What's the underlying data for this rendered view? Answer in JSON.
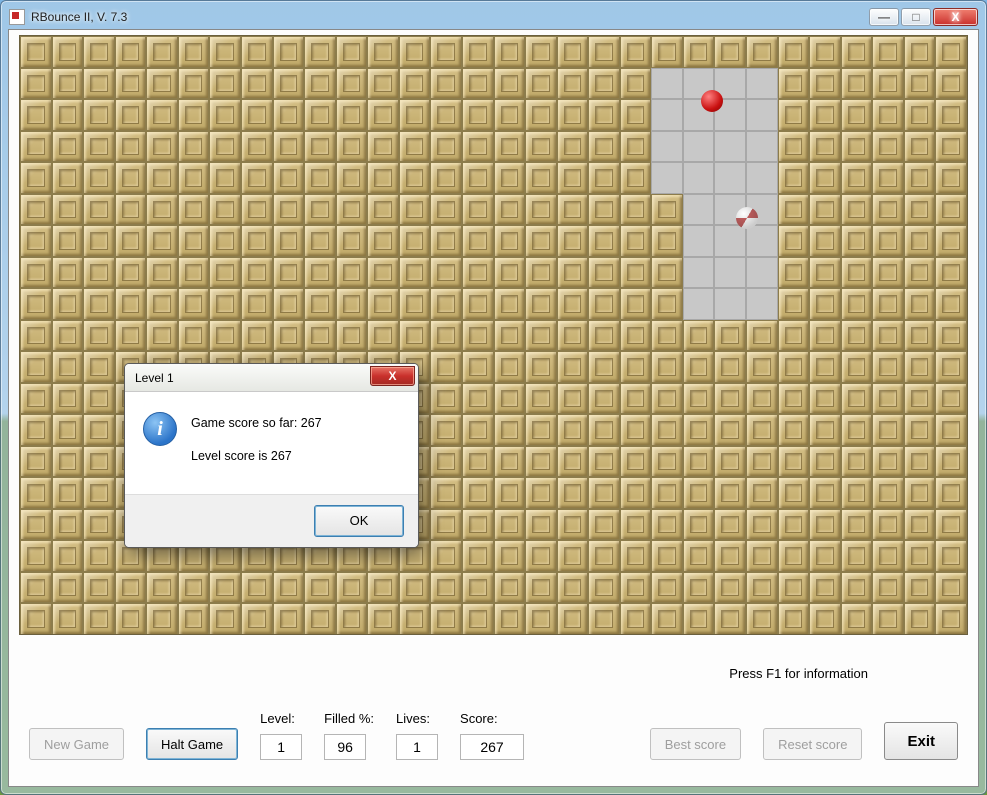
{
  "window": {
    "title": "RBounce II, V. 7.3"
  },
  "caption_buttons": {
    "min_glyph": "—",
    "max_glyph": "□",
    "close_glyph": "X"
  },
  "hint": "Press F1 for information",
  "buttons": {
    "new_game": "New Game",
    "halt_game": "Halt Game",
    "best_score": "Best score",
    "reset_score": "Reset score",
    "exit": "Exit"
  },
  "stats": {
    "level_label": "Level:",
    "level_value": "1",
    "filled_label": "Filled %:",
    "filled_value": "96",
    "lives_label": "Lives:",
    "lives_value": "1",
    "score_label": "Score:",
    "score_value": "267"
  },
  "dialog": {
    "title": "Level 1",
    "line1": "Game score so far: 267",
    "line2": "Level score is 267",
    "ok": "OK",
    "close_glyph": "X",
    "info_glyph": "i"
  },
  "grid": {
    "cols": 30,
    "rows": 19,
    "empty_cells": [
      [
        1,
        20
      ],
      [
        1,
        21
      ],
      [
        1,
        22
      ],
      [
        1,
        23
      ],
      [
        2,
        20
      ],
      [
        2,
        21
      ],
      [
        2,
        22
      ],
      [
        2,
        23
      ],
      [
        3,
        20
      ],
      [
        3,
        21
      ],
      [
        3,
        22
      ],
      [
        3,
        23
      ],
      [
        4,
        20
      ],
      [
        4,
        21
      ],
      [
        4,
        22
      ],
      [
        4,
        23
      ],
      [
        5,
        21
      ],
      [
        5,
        22
      ],
      [
        5,
        23
      ],
      [
        6,
        21
      ],
      [
        6,
        22
      ],
      [
        6,
        23
      ],
      [
        7,
        21
      ],
      [
        7,
        22
      ],
      [
        7,
        23
      ],
      [
        8,
        21
      ],
      [
        8,
        22
      ],
      [
        8,
        23
      ]
    ]
  },
  "balls": {
    "red": {
      "col": 21.7,
      "row": 1.6
    },
    "white": {
      "col": 22.8,
      "row": 5.3
    }
  }
}
